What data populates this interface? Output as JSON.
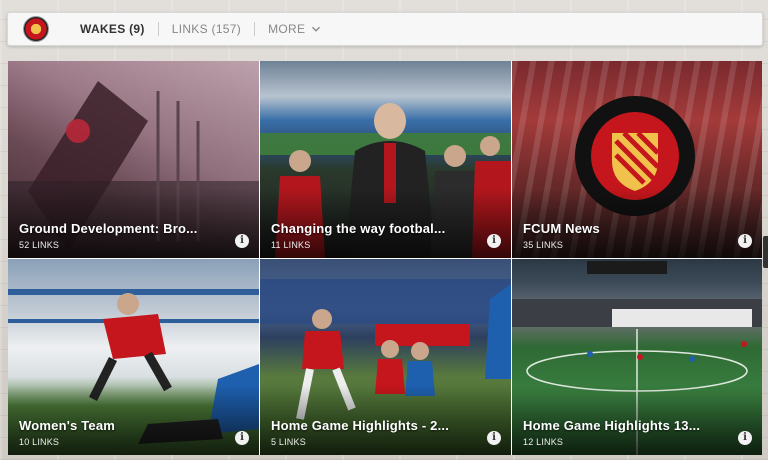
{
  "topbar": {
    "tabs": [
      {
        "label": "WAKES (9)"
      },
      {
        "label": "LINKS (157)"
      },
      {
        "label": "MORE"
      }
    ]
  },
  "cards": [
    {
      "title": "Ground Development: Bro...",
      "count": "52 LINKS"
    },
    {
      "title": "Changing the way footbal...",
      "count": "11 LINKS"
    },
    {
      "title": "FCUM News",
      "count": "35 LINKS"
    },
    {
      "title": "Women's Team",
      "count": "10 LINKS"
    },
    {
      "title": "Home Game Highlights - 2...",
      "count": "5 LINKS"
    },
    {
      "title": "Home Game Highlights 13...",
      "count": "12 LINKS"
    }
  ],
  "icons": {
    "info": "i",
    "logo": "club-crest-icon",
    "more": "chevron-down-icon"
  },
  "colors": {
    "accent_red": "#c4161c",
    "crest_gold": "#f0c24b",
    "topbar_bg": "#f7f7f7"
  }
}
